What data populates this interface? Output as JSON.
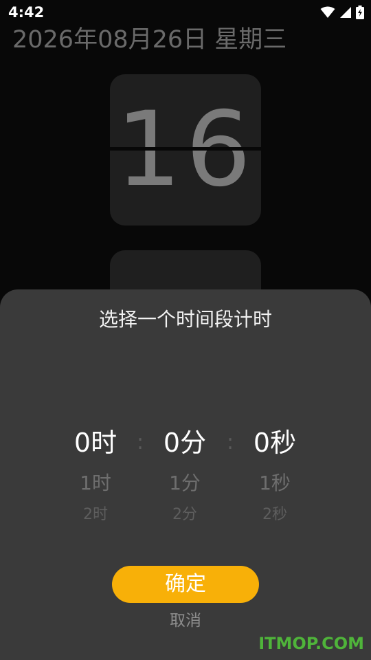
{
  "status_bar": {
    "time": "4:42",
    "icons": [
      "wifi-icon",
      "cellular-signal-icon",
      "battery-charging-icon"
    ]
  },
  "clock": {
    "date_text": "2026年08月26日 星期三",
    "hour_digits": "16",
    "minute_digits": ""
  },
  "timer_sheet": {
    "title": "选择一个时间段计时",
    "separator": ":",
    "hours": {
      "selected": "0时",
      "next": "1时",
      "next2": "2时"
    },
    "minutes": {
      "selected": "0分",
      "next": "1分",
      "next2": "2分"
    },
    "seconds": {
      "selected": "0秒",
      "next": "1秒",
      "next2": "2秒"
    },
    "confirm_label": "确定",
    "cancel_label": "取消"
  },
  "watermark": "ITMOP.COM",
  "colors": {
    "background": "#080808",
    "card": "#1f1f1f",
    "sheet": "#3a3a3a",
    "accent": "#f8b008",
    "watermark": "#4fb43a"
  }
}
